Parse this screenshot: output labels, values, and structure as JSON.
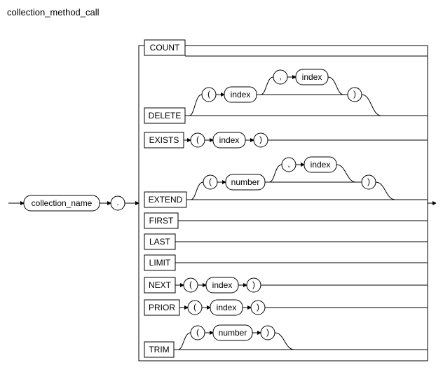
{
  "title": "collection_method_call",
  "entry": "collection_name",
  "dot": ".",
  "lparen": "(",
  "rparen": ")",
  "comma": ",",
  "index": "index",
  "number": "number",
  "methods": {
    "count": "COUNT",
    "delete": "DELETE",
    "exists": "EXISTS",
    "extend": "EXTEND",
    "first": "FIRST",
    "last": "LAST",
    "limit": "LIMIT",
    "next": "NEXT",
    "prior": "PRIOR",
    "trim": "TRIM"
  }
}
